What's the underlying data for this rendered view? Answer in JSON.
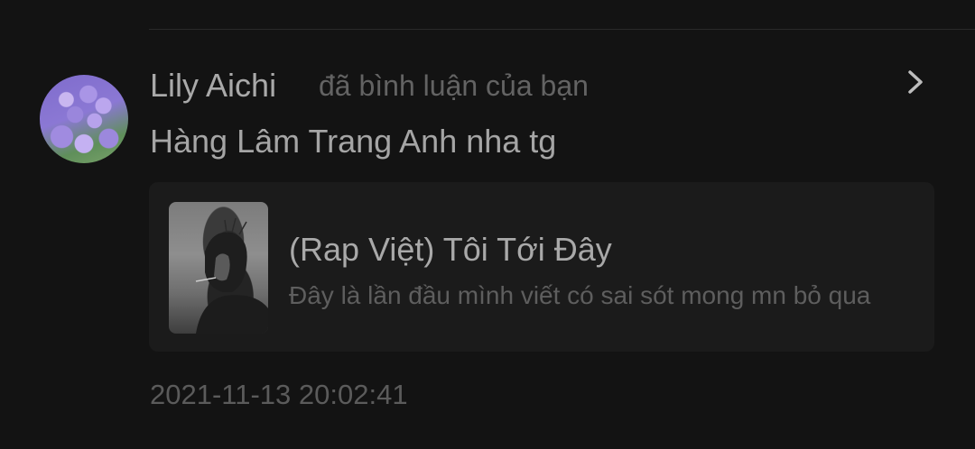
{
  "notification": {
    "author": "Lily Aichi",
    "action": "đã bình luận của bạn",
    "comment": "Hàng Lâm Trang Anh nha tg",
    "timestamp": "2021-11-13 20:02:41",
    "avatar_icon": "hydrangea-avatar",
    "chevron_icon": "chevron-right-icon"
  },
  "story_card": {
    "title": "(Rap Việt) Tôi Tới Đây",
    "description": "Đây là lần đầu mình viết có sai sót mong mn bỏ qua",
    "thumbnail": "story-cover-image"
  },
  "colors": {
    "background": "#131313",
    "card_background": "#1b1b1b",
    "primary_text": "#a9a9a9",
    "secondary_text": "#636363"
  }
}
